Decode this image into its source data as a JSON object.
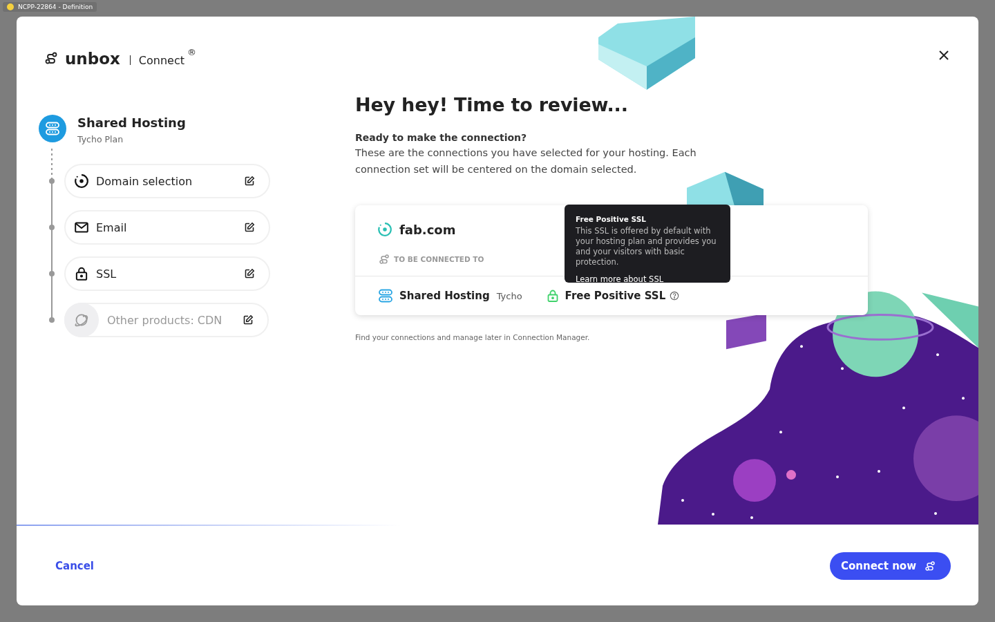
{
  "window": {
    "title": "NCPP-22864 - Definition"
  },
  "brand": {
    "name": "unbox",
    "product": "Connect",
    "mark": "®"
  },
  "plan": {
    "title": "Shared Hosting",
    "subtitle": "Tycho Plan"
  },
  "steps": [
    {
      "kind": "domain",
      "label": "Domain selection",
      "disabled": false
    },
    {
      "kind": "email",
      "label": "Email",
      "disabled": false
    },
    {
      "kind": "ssl",
      "label": "SSL",
      "disabled": false
    },
    {
      "kind": "cdn",
      "label": "Other products: CDN",
      "disabled": true
    }
  ],
  "heading": "Hey hey! Time to review...",
  "intro": {
    "title": "Ready to make the connection?",
    "body": "These are the connections you have selected for your hosting. Each connection set will be centered on the domain selected."
  },
  "connection": {
    "domain": "fab.com",
    "caption": "TO BE CONNECTED TO",
    "items": [
      {
        "kind": "hosting",
        "name": "Shared Hosting",
        "detail": "Tycho"
      },
      {
        "kind": "ssl",
        "name": "Free Positive SSL",
        "help": true
      }
    ]
  },
  "tooltip": {
    "title": "Free Positive SSL",
    "body": "This SSL is offered by default with your hosting plan and provides you and your visitors with basic protection.",
    "link": "Learn more about SSL"
  },
  "note": "Find your connections and manage later in Connection Manager.",
  "footer": {
    "cancel": "Cancel",
    "confirm": "Connect now"
  }
}
